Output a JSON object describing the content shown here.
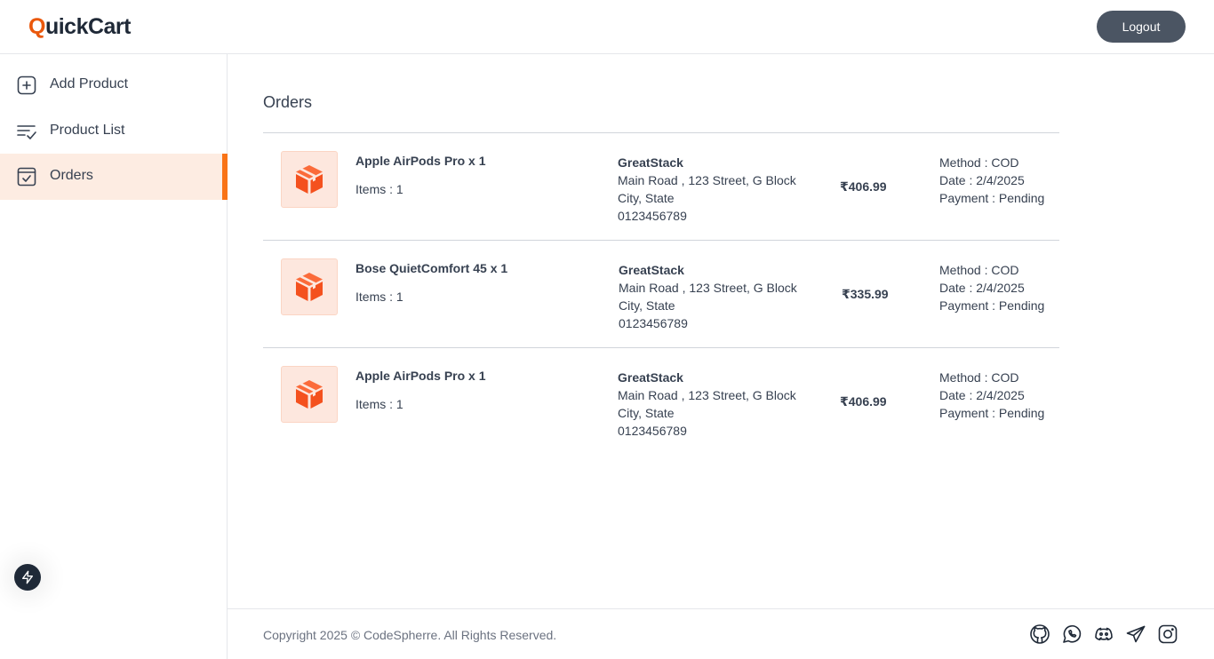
{
  "header": {
    "logo_first": "Q",
    "logo_rest": "uickCart",
    "logout_label": "Logout"
  },
  "sidebar": {
    "items": [
      {
        "label": "Add Product",
        "icon": "add-square-icon"
      },
      {
        "label": "Product List",
        "icon": "list-check-icon"
      },
      {
        "label": "Orders",
        "icon": "checkbox-icon",
        "active": true
      }
    ]
  },
  "main": {
    "title": "Orders",
    "orders": [
      {
        "product": "Apple AirPods Pro x 1",
        "items": "Items : 1",
        "customer": "GreatStack",
        "address": "Main Road , 123 Street, G Block",
        "city": "City, State",
        "phone": "0123456789",
        "amount": "₹406.99",
        "method": "Method : COD",
        "date": "Date : 2/4/2025",
        "payment": "Payment : Pending"
      },
      {
        "product": "Bose QuietComfort 45 x 1",
        "items": "Items : 1",
        "customer": "GreatStack",
        "address": "Main Road , 123 Street, G Block",
        "city": "City, State",
        "phone": "0123456789",
        "amount": "₹335.99",
        "method": "Method : COD",
        "date": "Date : 2/4/2025",
        "payment": "Payment : Pending"
      },
      {
        "product": "Apple AirPods Pro x 1",
        "items": "Items : 1",
        "customer": "GreatStack",
        "address": "Main Road , 123 Street, G Block",
        "city": "City, State",
        "phone": "0123456789",
        "amount": "₹406.99",
        "method": "Method : COD",
        "date": "Date : 2/4/2025",
        "payment": "Payment : Pending"
      }
    ]
  },
  "footer": {
    "copyright": "Copyright 2025 © CodeSpherre. All Rights Reserved.",
    "socials": [
      "github-icon",
      "whatsapp-icon",
      "discord-icon",
      "telegram-icon",
      "instagram-icon"
    ]
  },
  "colors": {
    "accent": "#ea580c",
    "active_bg": "#fdece2",
    "logout_bg": "#4b5563"
  }
}
